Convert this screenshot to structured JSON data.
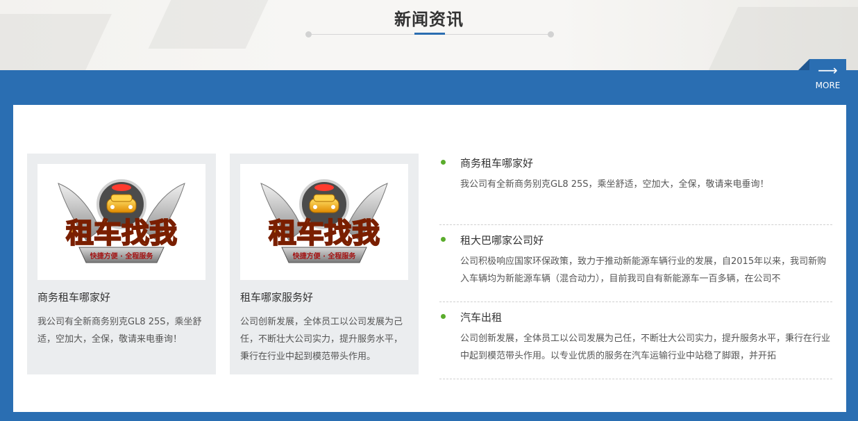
{
  "section": {
    "title": "新闻资讯",
    "more_label": "MORE",
    "more_icon": "arrow-right-icon"
  },
  "colors": {
    "brand_blue": "#2a6eb2",
    "bullet_green": "#5aac2c",
    "card_bg": "#ebedef"
  },
  "cards": [
    {
      "title": "商务租车哪家好",
      "text": "我公司有全新商务别克GL8 25S，乘坐舒适，空加大，全保，敬请来电垂询！",
      "image": {
        "logo_text": "租车找我",
        "tagline": "快捷方便 · 全程服务"
      }
    },
    {
      "title": "租车哪家服务好",
      "text": "公司创新发展，全体员工以公司发展为己任，不断壮大公司实力，提升服务水平，秉行在行业中起到模范带头作用。",
      "image": {
        "logo_text": "租车找我",
        "tagline": "快捷方便 · 全程服务"
      }
    }
  ],
  "news": [
    {
      "title": "商务租车哪家好",
      "text": "我公司有全新商务别克GL8 25S，乘坐舒适，空加大，全保，敬请来电垂询！"
    },
    {
      "title": "租大巴哪家公司好",
      "text": "公司积极响应国家环保政策，致力于推动新能源车辆行业的发展，自2015年以来，我司新购入车辆均为新能源车辆（混合动力），目前我司自有新能源车一百多辆，在公司不"
    },
    {
      "title": "汽车出租",
      "text": "公司创新发展，全体员工以公司发展为己任，不断壮大公司实力，提升服务水平，秉行在行业中起到模范带头作用。以专业优质的服务在汽车运输行业中站稳了脚跟，并开拓"
    }
  ]
}
